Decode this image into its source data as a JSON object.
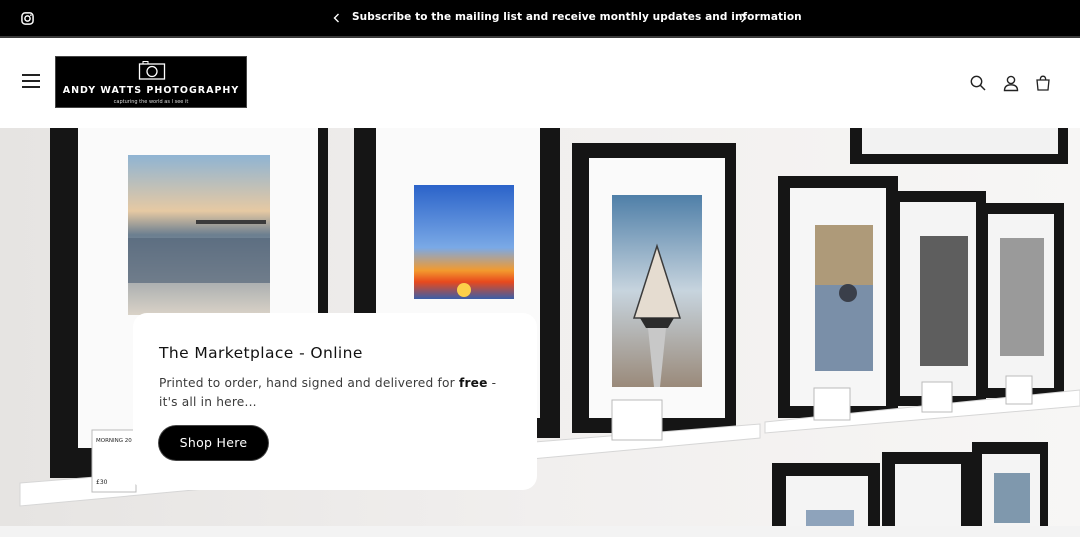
{
  "announcement": {
    "message": "Subscribe to the mailing list and receive monthly updates and information"
  },
  "header": {
    "logo_title": "ANDY WATTS PHOTOGRAPHY",
    "logo_tagline": "capturing the world as I see it"
  },
  "hero": {
    "title": "The Marketplace - Online",
    "text_before": "Printed to order, hand signed and delivered for ",
    "text_bold": "free",
    "text_after": " - it's all in here...",
    "button_label": "Shop Here",
    "labels": {
      "left_card_title": "MORNING 20",
      "left_card_price": "£30"
    }
  },
  "colors": {
    "bar": "#000000",
    "button": "#000000",
    "card": "#ffffff"
  },
  "icons": [
    "instagram-icon",
    "chevron-left-icon",
    "chevron-right-icon",
    "menu-icon",
    "camera-logo-icon",
    "search-icon",
    "account-icon",
    "cart-icon"
  ]
}
